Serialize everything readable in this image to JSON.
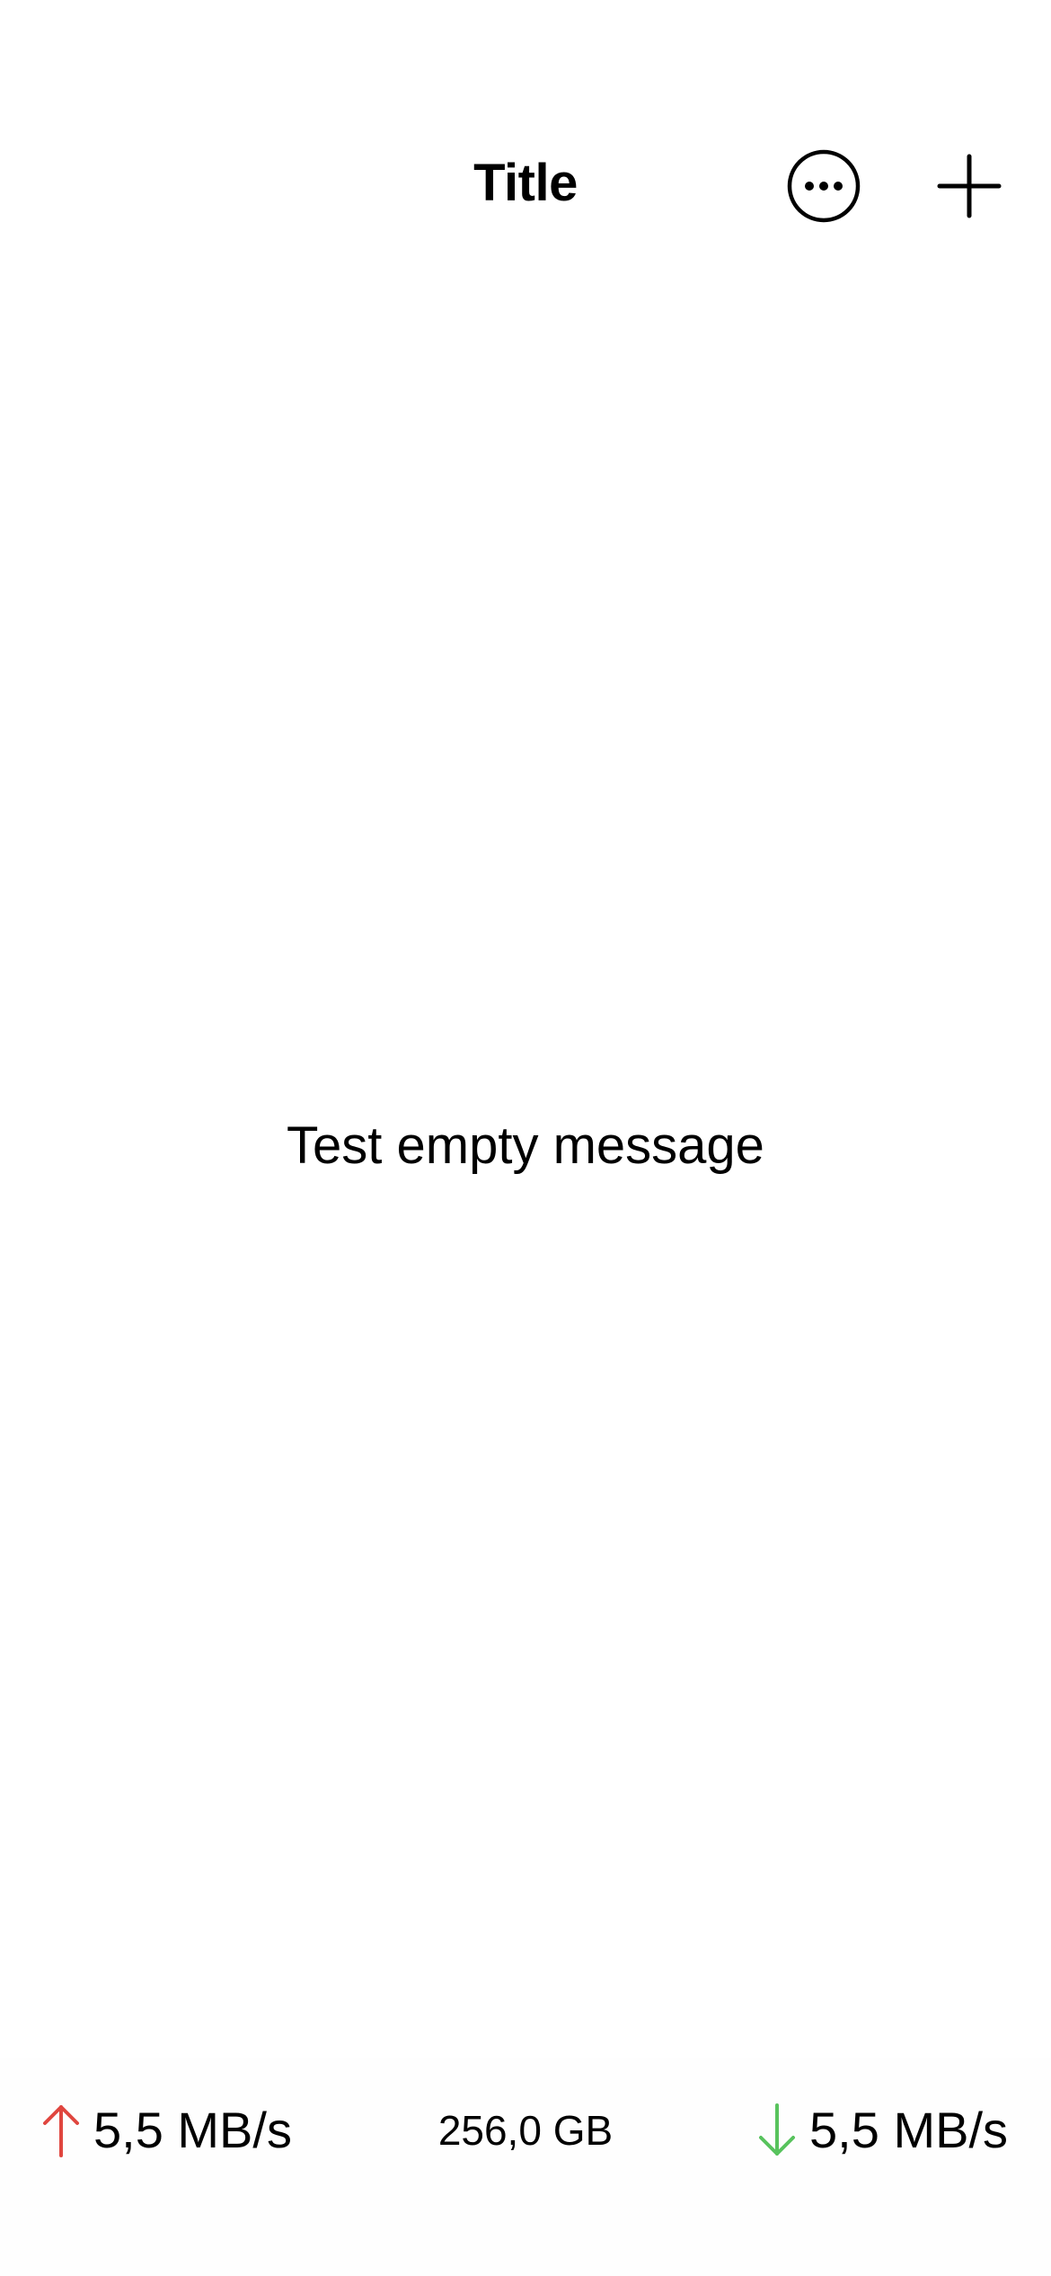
{
  "nav": {
    "title": "Title",
    "more_icon": "ellipsis-circle-icon",
    "add_icon": "plus-icon"
  },
  "empty_state": {
    "message": "Test empty message"
  },
  "status_bar": {
    "upload_rate": "5,5 MB/s",
    "upload_icon": "arrow-up-icon",
    "upload_color": "#e0463f",
    "storage": "256,0 GB",
    "download_rate": "5,5 MB/s",
    "download_icon": "arrow-down-icon",
    "download_color": "#58c35d"
  }
}
